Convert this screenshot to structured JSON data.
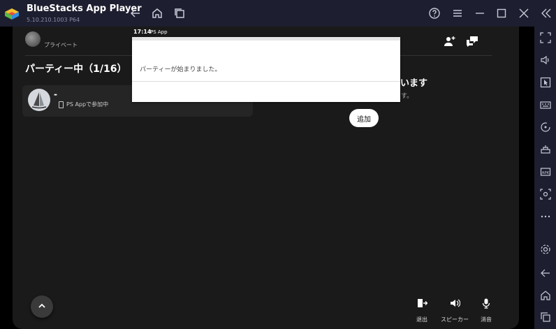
{
  "window": {
    "title": "BlueStacks App Player",
    "version": "5.10.210.1003 P64"
  },
  "status_bar": {
    "time": "17:14",
    "app": "PS App"
  },
  "party": {
    "privacy_label": "プライベート",
    "title": "パーティー中（1/16）",
    "member": {
      "name": "-",
      "status": "PS Appで参加中"
    },
    "right_heading": "います",
    "right_sub": "す。",
    "add_button_label": "追加"
  },
  "notification": {
    "message": "パーティーが始まりました。"
  },
  "controls": {
    "leave_label": "退出",
    "speaker_label": "スピーカー",
    "mute_label": "消音"
  },
  "colors": {
    "titlebar": "#1d1e2f",
    "background": "#1a1a1a",
    "card": "#252525"
  }
}
